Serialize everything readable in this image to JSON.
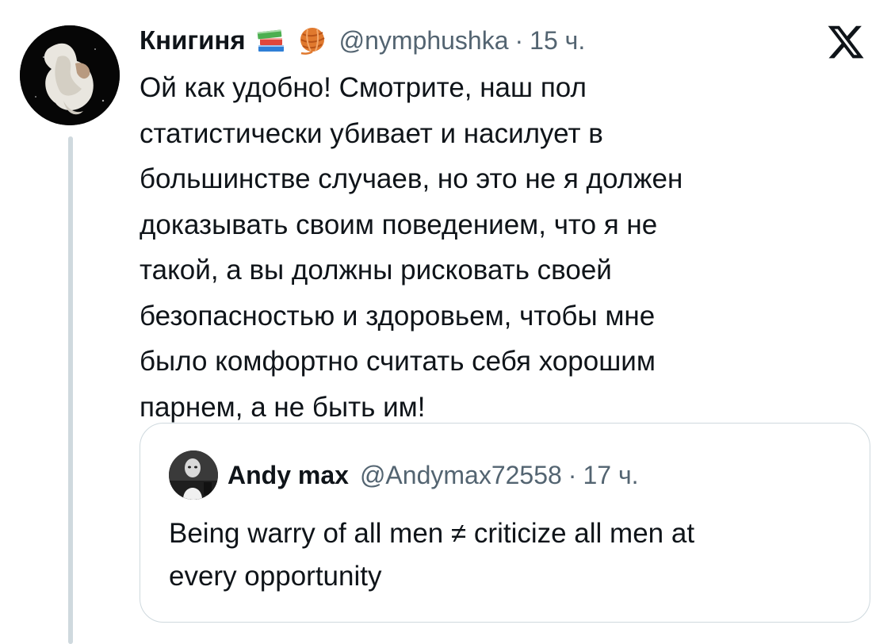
{
  "tweet": {
    "display_name": "Книгиня",
    "emojis": [
      "books-icon",
      "yarn-icon"
    ],
    "handle": "@nymphushka",
    "separator": "·",
    "time": "15 ч.",
    "text_lines": [
      "Ой как удобно! Смотрите, наш пол",
      "статистически убивает и насилует в",
      "большинстве случаев, но это не я должен",
      "доказывать своим поведением, что я не",
      "такой, а вы должны рисковать своей",
      "безопасностью и здоровьем, чтобы мне",
      "было комфортно считать себя хорошим",
      "парнем, а не быть им!"
    ]
  },
  "quote": {
    "display_name": "Andy max",
    "handle": "@Andymax72558",
    "separator": "·",
    "time": "17 ч.",
    "text_lines": [
      "Being warry of all men ≠ criticize all men at",
      "every opportunity"
    ]
  },
  "colors": {
    "text": "#0f1419",
    "secondary": "#536471",
    "border": "#cfd9de",
    "background": "#ffffff"
  }
}
